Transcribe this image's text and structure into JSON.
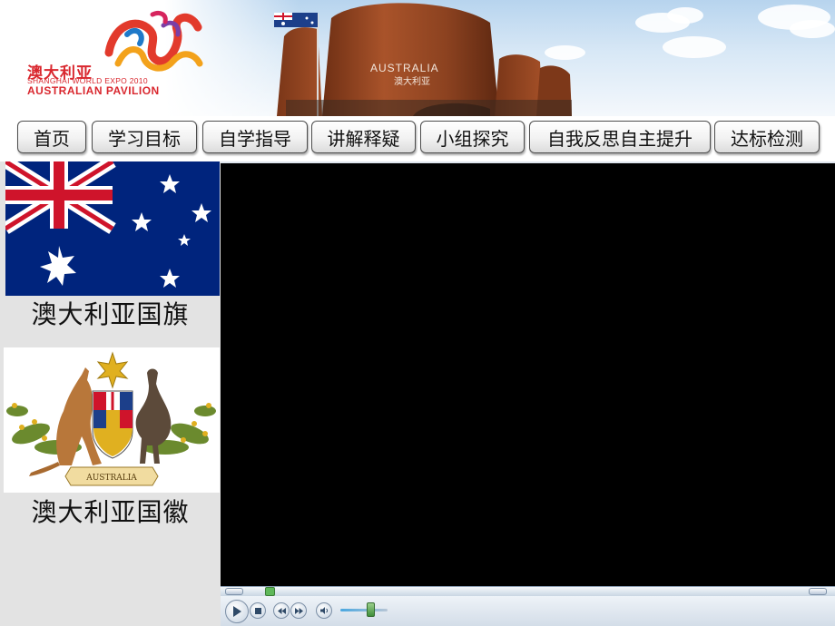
{
  "banner": {
    "logo": {
      "name_cn": "澳大利亚",
      "line1": "SHANGHAI WORLD EXPO 2010",
      "line2": "AUSTRALIAN PAVILION"
    },
    "pavilion_sign": {
      "name_en": "AUSTRALIA",
      "name_cn": "澳大利亚"
    }
  },
  "nav": {
    "items": [
      {
        "label": "首页"
      },
      {
        "label": "学习目标"
      },
      {
        "label": "自学指导"
      },
      {
        "label": "讲解释疑"
      },
      {
        "label": "小组探究"
      },
      {
        "label": "自我反思自主提升"
      },
      {
        "label": "达标检测"
      }
    ]
  },
  "sidebar": {
    "flag_caption": "澳大利亚国旗",
    "coat_caption": "澳大利亚国徽",
    "coat_banner_text": "AUSTRALIA"
  },
  "player": {
    "controls": {
      "play_icon": "play-icon",
      "stop_icon": "stop-icon",
      "prev_icon": "previous-icon",
      "next_icon": "next-icon",
      "mute_icon": "speaker-icon"
    },
    "seek_progress": 0.04,
    "volume_level": 0.62
  },
  "colors": {
    "flag_blue": "#00247d",
    "flag_red": "#cf142b",
    "logo_red": "#d9272e",
    "pavilion_rust": "#9a4a24",
    "video_bg": "#000000"
  }
}
